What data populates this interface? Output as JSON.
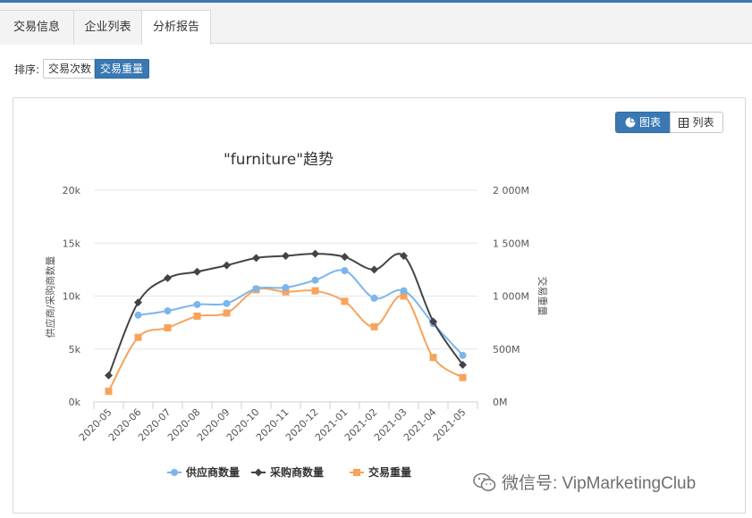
{
  "tabs": [
    {
      "label": "交易信息"
    },
    {
      "label": "企业列表"
    },
    {
      "label": "分析报告",
      "active": true
    }
  ],
  "sort": {
    "label": "排序:",
    "options": [
      "交易次数",
      "交易重量"
    ],
    "selected": "交易重量"
  },
  "view_toggle": {
    "chart_label": "图表",
    "list_label": "列表",
    "selected": "图表"
  },
  "chart_data": {
    "type": "line",
    "title": "\"furniture\"趋势",
    "categories": [
      "2020-05",
      "2020-06",
      "2020-07",
      "2020-08",
      "2020-09",
      "2020-10",
      "2020-11",
      "2020-12",
      "2021-01",
      "2021-02",
      "2021-03",
      "2021-04",
      "2021-05"
    ],
    "ylabel_left": "供应商/采购商数量",
    "ylabel_right": "交易重量",
    "yticks_left": [
      "0k",
      "5k",
      "10k",
      "15k",
      "20k"
    ],
    "yticks_right": [
      "0M",
      "500M",
      "1 000M",
      "1 500M",
      "2 000M"
    ],
    "ylim_left": [
      0,
      20000
    ],
    "ylim_right": [
      0,
      2000
    ],
    "grid": true,
    "legend_position": "bottom",
    "series": [
      {
        "name": "供应商数量",
        "axis": "left",
        "color": "#7cb5ec",
        "marker": "circle",
        "values": [
          null,
          8200,
          8600,
          9200,
          9300,
          10700,
          10800,
          11500,
          12400,
          9800,
          10500,
          7400,
          4400
        ]
      },
      {
        "name": "采购商数量",
        "axis": "left",
        "color": "#434348",
        "marker": "diamond",
        "values": [
          2500,
          9400,
          11700,
          12300,
          12900,
          13600,
          13800,
          14000,
          13700,
          12500,
          13800,
          7600,
          3500
        ]
      },
      {
        "name": "交易重量",
        "axis": "right",
        "color": "#f7a35c",
        "marker": "square",
        "values": [
          100,
          610,
          700,
          810,
          840,
          1060,
          1040,
          1050,
          950,
          710,
          1000,
          420,
          230
        ]
      }
    ]
  },
  "watermark": {
    "text": "微信号: VipMarketingClub"
  }
}
